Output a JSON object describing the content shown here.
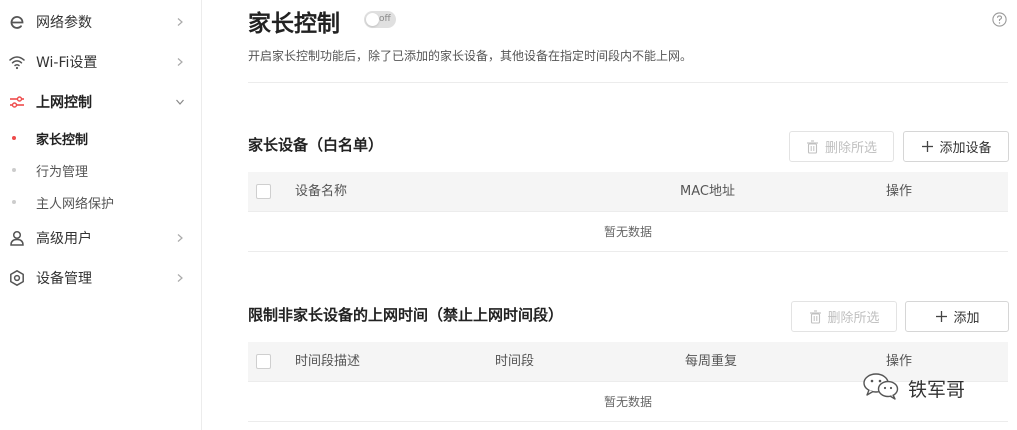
{
  "sidebar": {
    "items": [
      {
        "label": "网络参数",
        "icon": "network-e-icon"
      },
      {
        "label": "Wi-Fi设置",
        "icon": "wifi-icon"
      },
      {
        "label": "上网控制",
        "icon": "sliders-icon",
        "expanded": true,
        "children": [
          {
            "label": "家长控制",
            "active": true
          },
          {
            "label": "行为管理"
          },
          {
            "label": "主人网络保护"
          }
        ]
      },
      {
        "label": "高级用户",
        "icon": "user-icon"
      },
      {
        "label": "设备管理",
        "icon": "gear-icon"
      }
    ]
  },
  "page": {
    "title": "家长控制",
    "toggle_text": "off",
    "toggle_on": false,
    "description": "开启家长控制功能后，除了已添加的家长设备，其他设备在指定时间段内不能上网。"
  },
  "parent_devices": {
    "title": "家长设备（白名单）",
    "delete_label": "删除所选",
    "add_label": "添加设备",
    "columns": [
      "设备名称",
      "MAC地址",
      "操作"
    ],
    "empty_text": "暂无数据"
  },
  "time_limits": {
    "title": "限制非家长设备的上网时间（禁止上网时间段）",
    "delete_label": "删除所选",
    "add_label": "添加",
    "columns": [
      "时间段描述",
      "时间段",
      "每周重复",
      "操作"
    ],
    "empty_text": "暂无数据"
  },
  "watermark": {
    "text": "铁军哥",
    "icon": "wechat-icon"
  },
  "colors": {
    "accent": "#ee4b4b",
    "border": "#ececec",
    "header_bg": "#f5f5f5"
  }
}
